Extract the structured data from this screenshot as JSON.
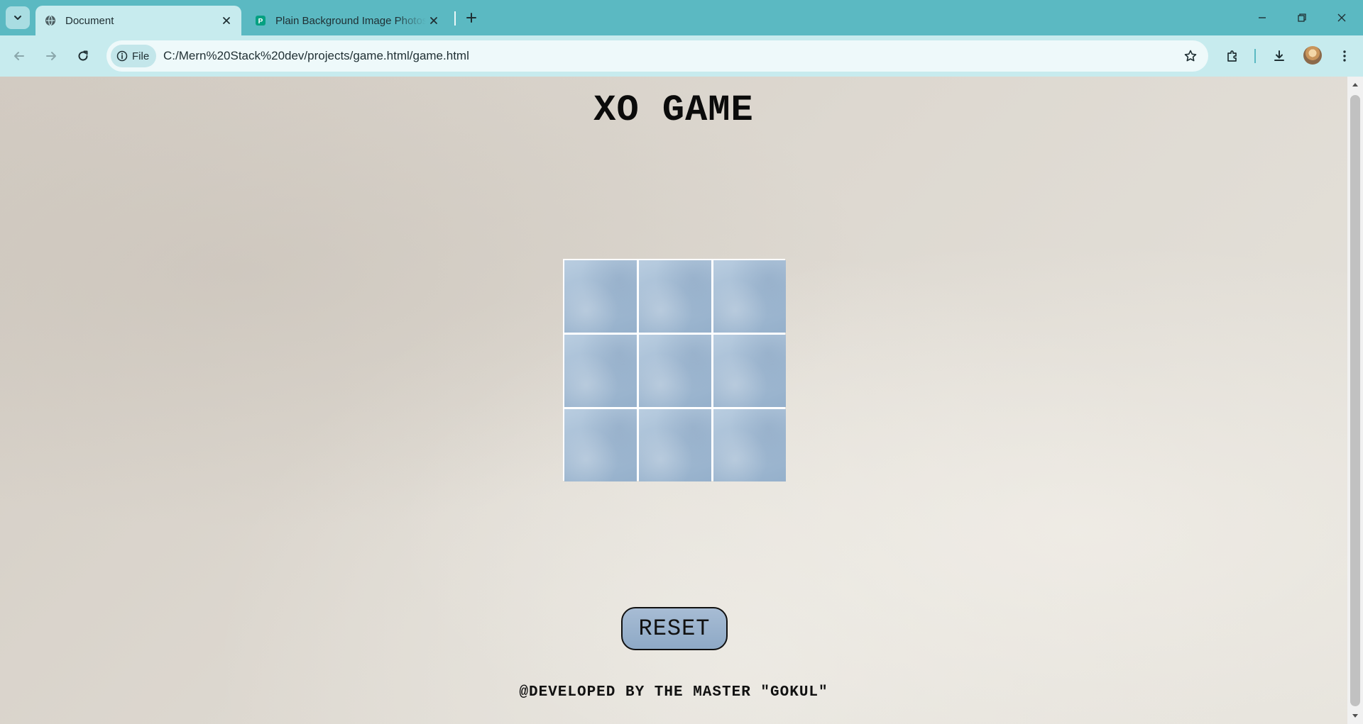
{
  "browser": {
    "tabs": [
      {
        "title": "Document",
        "favicon": "globe-icon",
        "active": true
      },
      {
        "title": "Plain Background Image Photos",
        "favicon": "pexels-icon",
        "active": false
      }
    ],
    "address": {
      "chip_label": "File",
      "url": "C:/Mern%20Stack%20dev/projects/game.html/game.html"
    }
  },
  "page": {
    "title": "XO GAME",
    "board": {
      "cells": [
        "",
        "",
        "",
        "",
        "",
        "",
        "",
        "",
        ""
      ]
    },
    "reset_label": "RESET",
    "credit": "@DEVELOPED BY THE MASTER \"GOKUL\""
  },
  "colors": {
    "chrome_accent": "#5bb9c2",
    "toolbar_bg": "#c7ebee",
    "cell_blue": "#a3bbd3",
    "button_blue": "#a7bcd4",
    "page_bg": "#ddd8d0"
  }
}
